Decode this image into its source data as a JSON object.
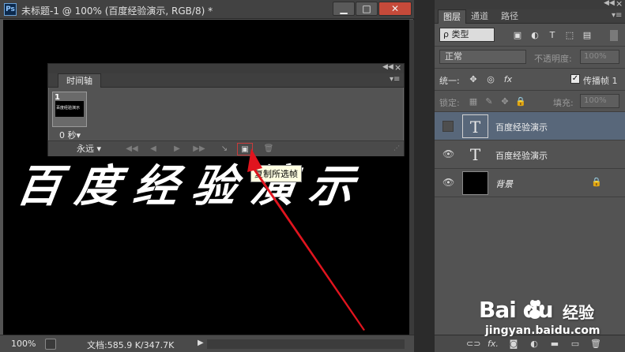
{
  "document": {
    "app_logo": "Ps",
    "title": "未标题-1 @ 100% (百度经验演示, RGB/8) *",
    "window_buttons": {
      "minimize": "▁",
      "maximize": "□",
      "close": "✕"
    },
    "canvas_text": "百度经验演示",
    "status": {
      "zoom": "100%",
      "doc_info": "文档:585.9 K/347.7K",
      "arrow": "▶"
    }
  },
  "timeline": {
    "tab_label": "时间轴",
    "frame": {
      "number": "1",
      "preview_text": "百度经验演示",
      "delay": "0 秒▾"
    },
    "loop": "永远 ▾",
    "controls": {
      "first": "◀◀",
      "prev": "◀",
      "play": "▶",
      "next": "▶▶",
      "tween": "↘",
      "duplicate": "▣",
      "delete": "🗑"
    },
    "tooltip": "复制所选帧"
  },
  "layers_panel": {
    "tabs": [
      "图层",
      "通道",
      "路径"
    ],
    "filter": "ρ 类型",
    "blend_mode": "正常",
    "opacity_label": "不透明度:",
    "opacity_value": "100%",
    "unify_label": "统一:",
    "propagate_label": "传播帧 1",
    "lock_label": "锁定:",
    "fill_label": "填充:",
    "fill_value": "100%",
    "layers": [
      {
        "name": "百度经验演示",
        "type": "text",
        "visible": false,
        "selected": true
      },
      {
        "name": "百度经验演示",
        "type": "text",
        "visible": true,
        "selected": false
      },
      {
        "name": "背景",
        "type": "background",
        "visible": true,
        "selected": false,
        "locked": true
      }
    ],
    "bottom_icons": [
      "link-icon",
      "fx-icon",
      "mask-icon",
      "adjustment-icon",
      "group-icon",
      "new-layer-icon",
      "delete-icon"
    ]
  },
  "watermark": {
    "brand": "Bai  du",
    "sub": "经验",
    "url": "jingyan.baidu.com"
  },
  "colors": {
    "panel": "#535353",
    "selected_layer": "#58677a",
    "arrow": "#e0141e",
    "highlight_box": "#c83c3c"
  }
}
